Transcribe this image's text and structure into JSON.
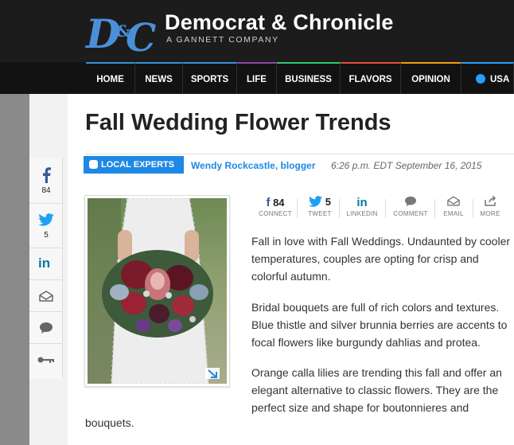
{
  "header": {
    "brand_name": "Democrat & Chronicle",
    "brand_tagline": "A GANNETT COMPANY",
    "logo_text": "D&C"
  },
  "nav": {
    "items": [
      {
        "label": "HOME",
        "accent": "#3a8fd6"
      },
      {
        "label": "NEWS",
        "accent": "#3a8fd6"
      },
      {
        "label": "SPORTS",
        "accent": "#3a8fd6"
      },
      {
        "label": "LIFE",
        "accent": "#8e44ad"
      },
      {
        "label": "BUSINESS",
        "accent": "#2ecc71"
      },
      {
        "label": "FLAVORS",
        "accent": "#e74c3c"
      },
      {
        "label": "OPINION",
        "accent": "#f39c12"
      },
      {
        "label": "USA T",
        "accent": "#2a9df4"
      }
    ]
  },
  "side_share": {
    "facebook_count": "84",
    "twitter_count": "5"
  },
  "article": {
    "title": "Fall Wedding Flower Trends",
    "badge": "LOCAL EXPERTS",
    "author": "Wendy Rockcastle, blogger",
    "timestamp": "6:26 p.m. EDT September 16, 2015",
    "paragraphs": [
      "Fall in love with Fall Weddings. Undaunted by cooler temperatures, couples are opting for crisp and colorful autumn.",
      "Bridal bouquets are full of rich colors and textures. Blue thistle and silver brunnia berries are accents to focal flowers like burgundy dahlias and protea.",
      "Orange calla lilies are trending this fall and offer an elegant alternative to classic flowers. They are the perfect size and shape for boutonnieres and"
    ],
    "paragraph_tail": "bouquets."
  },
  "share_bar": {
    "items": [
      {
        "count": "84",
        "label": "CONNECT",
        "icon": "facebook-icon"
      },
      {
        "count": "5",
        "label": "TWEET",
        "icon": "twitter-icon"
      },
      {
        "count": "",
        "label": "LINKEDIN",
        "icon": "linkedin-icon"
      },
      {
        "count": "",
        "label": "COMMENT",
        "icon": "comment-icon"
      },
      {
        "count": "",
        "label": "EMAIL",
        "icon": "email-icon"
      },
      {
        "count": "",
        "label": "MORE",
        "icon": "more-icon"
      }
    ]
  },
  "colors": {
    "accent_blue": "#1e88e5",
    "masthead_bg": "#1c1c1c",
    "nav_bg": "#121212"
  }
}
